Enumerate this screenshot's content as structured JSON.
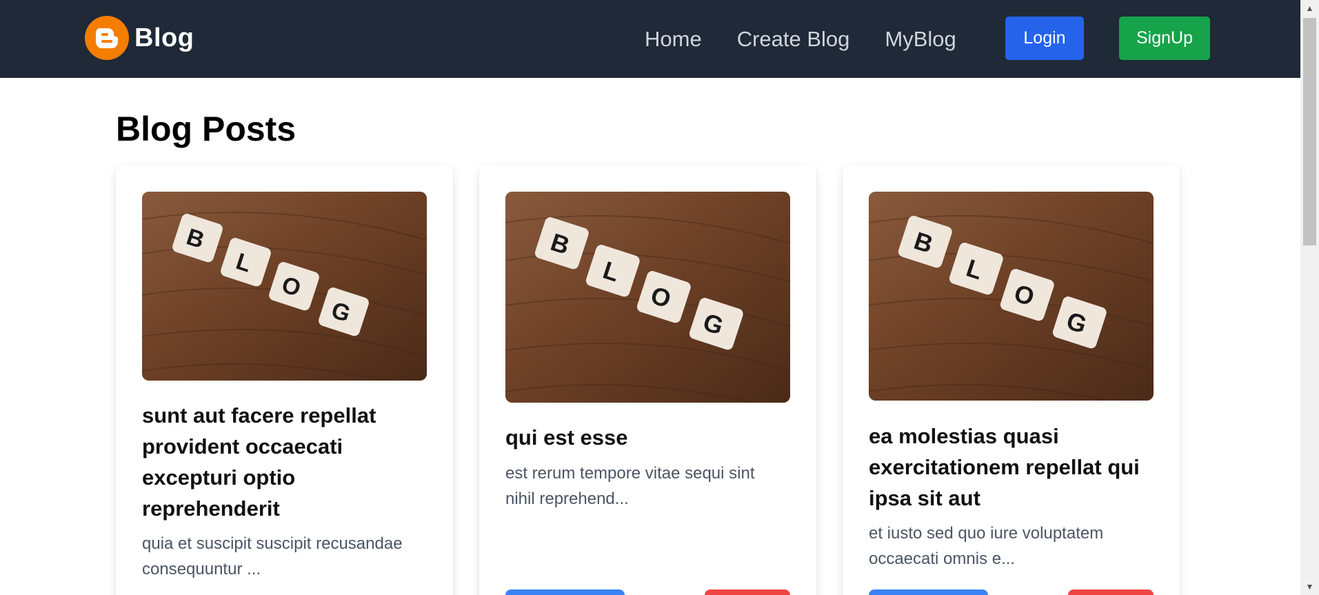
{
  "navbar": {
    "brand_text": "Blog",
    "links": [
      "Home",
      "Create Blog",
      "MyBlog"
    ],
    "login_label": "Login",
    "signup_label": "SignUp"
  },
  "main": {
    "title": "Blog Posts",
    "posts": [
      {
        "title_lines": [
          "sunt aut facere repellat",
          "provident occaecati",
          "excepturi optio",
          "reprehenderit"
        ],
        "desc_lines": [
          "quia et suscipit suscipit recusandae",
          "consequuntur ..."
        ]
      },
      {
        "title_lines": [
          "qui est esse"
        ],
        "desc_lines": [
          "est rerum tempore vitae sequi sint",
          "nihil reprehend..."
        ]
      },
      {
        "title_lines": [
          "ea molestias quasi",
          "exercitationem repellat qui",
          "ipsa sit aut"
        ],
        "desc_lines": [
          "et iusto sed quo iure voluptatem",
          "occaecati omnis e..."
        ]
      }
    ]
  },
  "colors": {
    "navbar_bg": "#1f2937",
    "login_bg": "#2563eb",
    "signup_bg": "#16a34a",
    "brand_logo": "#f57d00"
  },
  "icons": {
    "brand": "blogger-logo-icon",
    "scroll_up": "scroll-up-arrow-icon",
    "scroll_down": "scroll-down-arrow-icon"
  }
}
